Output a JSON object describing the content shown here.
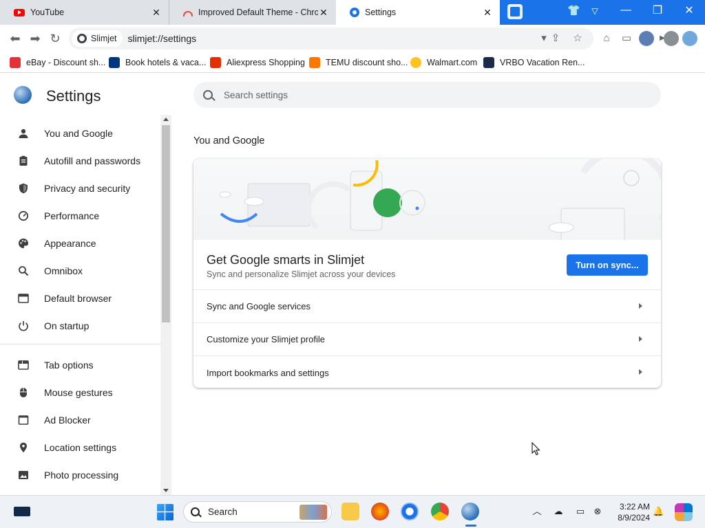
{
  "tabs": [
    {
      "title": "YouTube",
      "icon": "youtube-icon"
    },
    {
      "title": "Improved Default Theme - Chro",
      "icon": "rainbow-icon"
    },
    {
      "title": "Settings",
      "icon": "settings-gear-icon"
    }
  ],
  "omnibox": {
    "site_chip": "Slimjet",
    "url": "slimjet://settings"
  },
  "bookmarks": [
    {
      "label": "eBay - Discount sh...",
      "color": "#e53238"
    },
    {
      "label": "Book hotels & vaca...",
      "color": "#003580"
    },
    {
      "label": "Aliexpress Shopping",
      "color": "#e62e04"
    },
    {
      "label": "TEMU discount sho...",
      "color": "#fb7701"
    },
    {
      "label": "Walmart.com",
      "color": "#ffc220"
    },
    {
      "label": "VRBO Vacation Ren...",
      "color": "#1c2b49"
    }
  ],
  "settings": {
    "title": "Settings",
    "search_placeholder": "Search settings",
    "sidebar": [
      {
        "label": "You and Google",
        "icon": "person-icon"
      },
      {
        "label": "Autofill and passwords",
        "icon": "clipboard-icon"
      },
      {
        "label": "Privacy and security",
        "icon": "shield-icon"
      },
      {
        "label": "Performance",
        "icon": "speedometer-icon"
      },
      {
        "label": "Appearance",
        "icon": "palette-icon"
      },
      {
        "label": "Omnibox",
        "icon": "search-icon"
      },
      {
        "label": "Default browser",
        "icon": "browser-icon"
      },
      {
        "label": "On startup",
        "icon": "power-icon"
      },
      {
        "label": "Tab options",
        "icon": "tab-icon"
      },
      {
        "label": "Mouse gestures",
        "icon": "mouse-icon"
      },
      {
        "label": "Ad Blocker",
        "icon": "window-icon"
      },
      {
        "label": "Location settings",
        "icon": "location-pin-icon"
      },
      {
        "label": "Photo processing",
        "icon": "image-icon"
      }
    ],
    "section_title": "You and Google",
    "card": {
      "heading": "Get Google smarts in Slimjet",
      "subheading": "Sync and personalize Slimjet across your devices",
      "sync_button": "Turn on sync...",
      "rows": [
        "Sync and Google services",
        "Customize your Slimjet profile",
        "Import bookmarks and settings"
      ]
    }
  },
  "taskbar": {
    "search_label": "Search",
    "time": "3:22 AM",
    "date": "8/9/2024"
  },
  "colors": {
    "accent": "#1a73e8",
    "tab_strip": "#1a73e8"
  }
}
